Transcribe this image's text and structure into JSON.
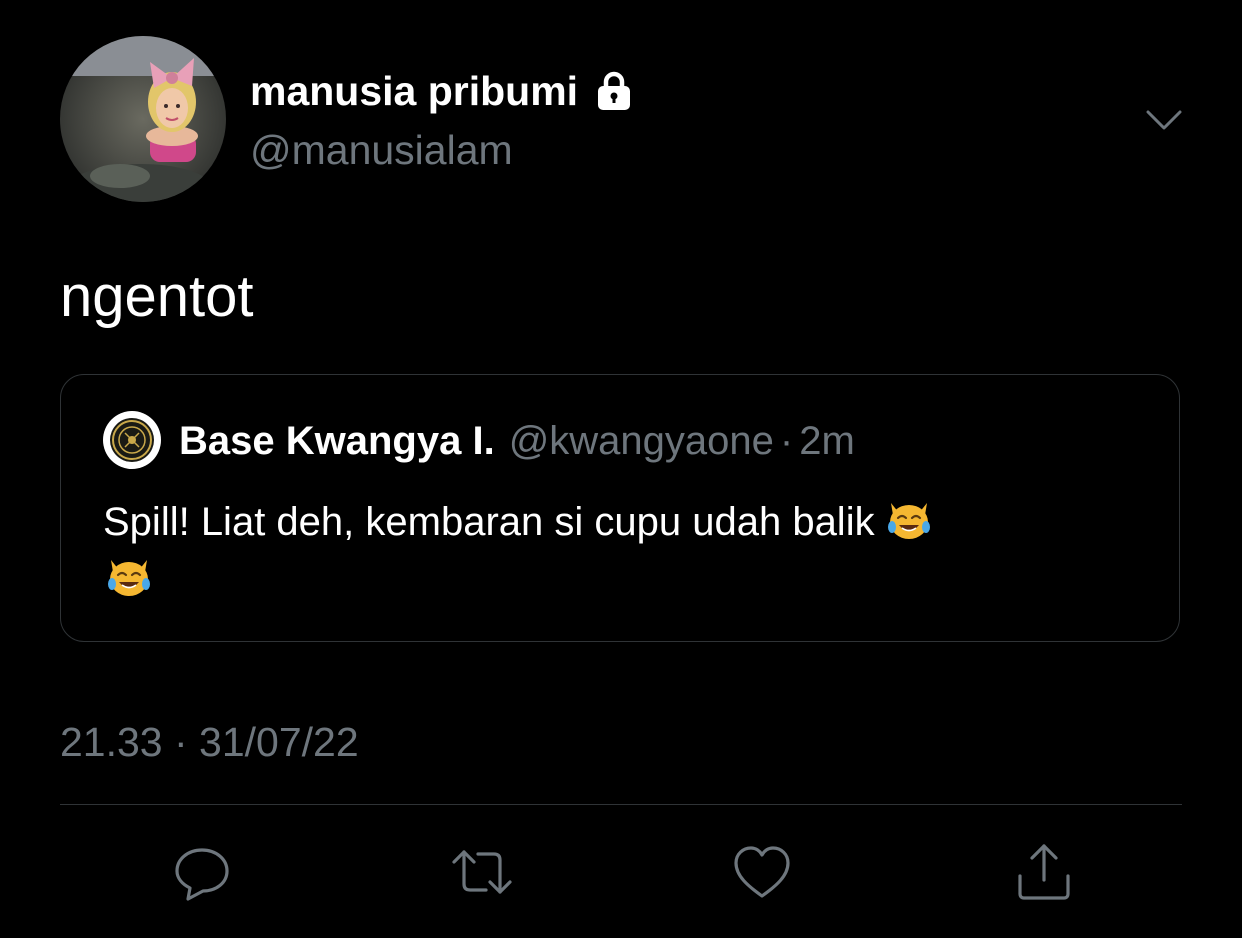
{
  "author": {
    "display_name": "manusia pribumi",
    "handle": "@manusialam",
    "protected_icon": "lock-icon",
    "avatar": "profile-avatar"
  },
  "tweet": {
    "text": "ngentot",
    "menu_icon": "chevron-down-icon"
  },
  "quoted_tweet": {
    "display_name": "Base Kwangya I.",
    "handle": "@kwangyaone",
    "separator": "·",
    "time": "2m",
    "text": "Spill! Liat deh, kembaran si cupu udah balik",
    "emojis": [
      "😹",
      "😹"
    ]
  },
  "meta": {
    "timestamp": "21.33 · 31/07/22"
  },
  "actions": [
    {
      "name": "reply",
      "icon": "reply-icon"
    },
    {
      "name": "retweet",
      "icon": "retweet-icon"
    },
    {
      "name": "like",
      "icon": "heart-icon"
    },
    {
      "name": "share",
      "icon": "share-icon"
    }
  ],
  "colors": {
    "background": "#000000",
    "text_primary": "#ffffff",
    "text_secondary": "#6e767d",
    "border": "#2f3336"
  }
}
